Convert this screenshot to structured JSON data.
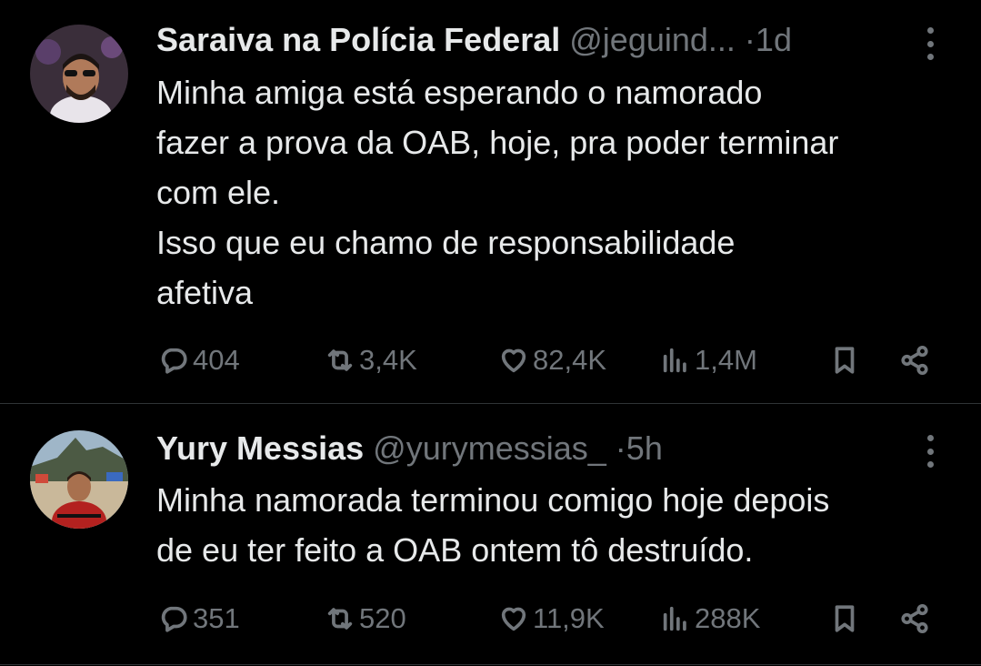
{
  "tweets": [
    {
      "name": "Saraiva na Polícia Federal",
      "handle": "@jeguind...",
      "dot": "·",
      "time": "1d",
      "lines": [
        "Minha amiga está esperando o namorado",
        "fazer a prova da OAB, hoje, pra poder terminar",
        "com ele.",
        "Isso que eu chamo de responsabilidade",
        "afetiva"
      ],
      "replies": "404",
      "retweets": "3,4K",
      "likes": "82,4K",
      "views": "1,4M"
    },
    {
      "name": "Yury Messias",
      "handle": "@yurymessias_",
      "dot": "·",
      "time": "5h",
      "lines": [
        "Minha namorada terminou comigo hoje depois",
        "de eu ter feito a OAB ontem tô destruído."
      ],
      "replies": "351",
      "retweets": "520",
      "likes": "11,9K",
      "views": "288K"
    }
  ],
  "icons": {
    "reply": "reply-icon",
    "retweet": "retweet-icon",
    "like": "heart-icon",
    "views": "views-icon",
    "bookmark": "bookmark-icon",
    "share": "share-icon",
    "more": "more-icon"
  },
  "colors": {
    "background": "#000000",
    "text": "#e7e9ea",
    "secondary": "#71767b",
    "divider": "#2f3336"
  }
}
